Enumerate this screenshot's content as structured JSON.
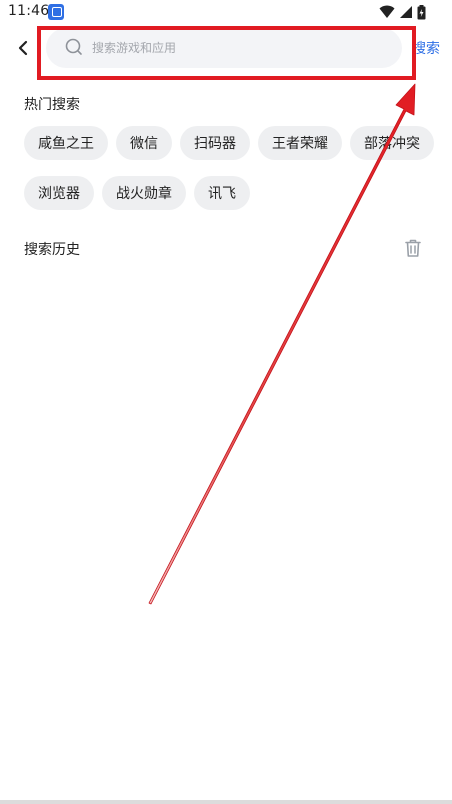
{
  "status_bar": {
    "time": "11:46",
    "icons": [
      "notification-app-icon",
      "wifi-icon",
      "signal-icon",
      "battery-icon"
    ]
  },
  "header": {
    "back_icon": "chevron-left-icon",
    "search_icon": "search-icon",
    "search_placeholder": "搜索游戏和应用",
    "search_value": "",
    "search_button": "搜索"
  },
  "hot_search": {
    "title": "热门搜索",
    "items": [
      "咸鱼之王",
      "微信",
      "扫码器",
      "王者荣耀",
      "部落冲突",
      "浏览器",
      "战火勋章",
      "讯飞"
    ]
  },
  "history": {
    "title": "搜索历史",
    "clear_icon": "trash-icon"
  },
  "colors": {
    "accent": "#2b6de5",
    "annotation": "#e11b22",
    "chip_bg": "#eeeff1",
    "search_bg": "#f3f4f7"
  }
}
